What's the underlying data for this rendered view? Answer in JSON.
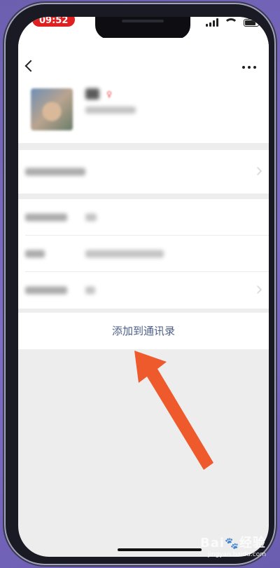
{
  "status_bar": {
    "time": "09:52"
  },
  "actions": {
    "add_to_contacts": "添加到通讯录"
  },
  "watermark": {
    "brand": "Bai",
    "brand_suffix": "经验",
    "url": "jingyan.baidu.com"
  },
  "colors": {
    "accent_link": "#4c5d8a",
    "arrow": "#ee5a2c",
    "background_gradient": "#7462bb"
  },
  "icons": [
    "back-chevron-icon",
    "more-dots-icon",
    "signal-icon",
    "wifi-icon",
    "battery-icon",
    "chevron-right-icon",
    "baidu-paw-icon"
  ]
}
